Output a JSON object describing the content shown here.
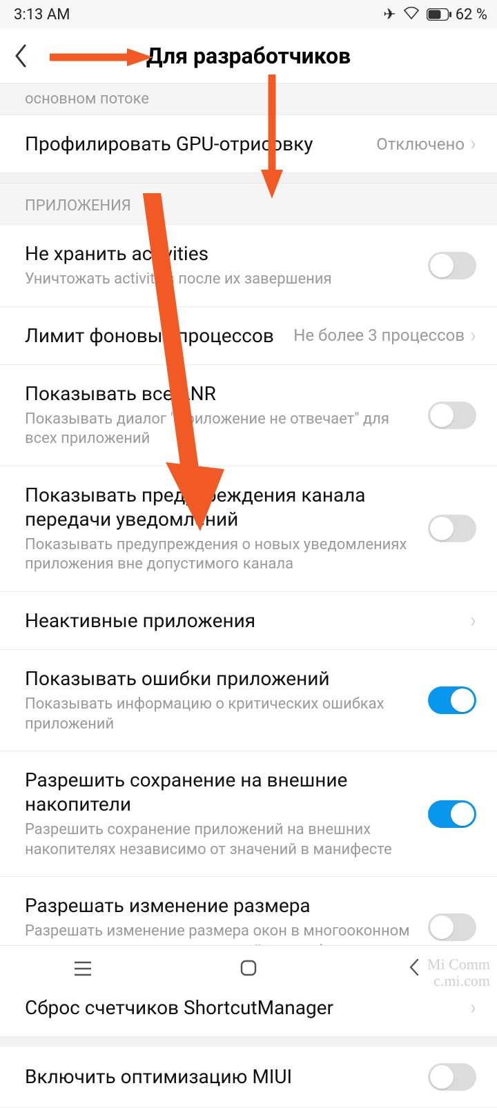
{
  "status": {
    "time": "3:13 AM",
    "battery_pct": "62 %"
  },
  "header": {
    "title": "Для разработчиков"
  },
  "sections": {
    "s0_header": "основном потоке",
    "gpu": {
      "title": "Профилировать GPU-отрисовку",
      "value": "Отключено"
    },
    "s1_header": "ПРИЛОЖЕНИЯ",
    "no_keep": {
      "title": "Не хранить activities",
      "sub": "Уничтожать activities после их завершения"
    },
    "bg_limit": {
      "title": "Лимит фоновых процессов",
      "value": "Не более 3 процессов"
    },
    "anr": {
      "title": "Показывать все ANR",
      "sub": "Показывать диалог \"Приложение не отвечает\" для всех приложений"
    },
    "notif_warn": {
      "title": "Показывать предупреждения канала передачи уведомлений",
      "sub": "Показывать предупреждения о новых уведомлениях приложения вне допустимого канала"
    },
    "inactive": {
      "title": "Неактивные приложения"
    },
    "app_errors": {
      "title": "Показывать ошибки приложений",
      "sub": "Показывать информацию о критических ошибках приложений"
    },
    "ext_storage": {
      "title": "Разрешить сохранение на внешние накопители",
      "sub": "Разрешить сохранение приложений на внешних накопителях независимо от значений в манифесте"
    },
    "resize": {
      "title": "Разрешать изменение размера",
      "sub": "Разрешать изменение размера окон в многооконном режиме независимо от значений в манифесте"
    },
    "shortcut_reset": {
      "title": "Сброс счетчиков ShortcutManager"
    },
    "miui_opt": {
      "title": "Включить оптимизацию MIUI"
    }
  },
  "watermark": {
    "line1": "Mi Comm",
    "line2": "c.mi.com"
  }
}
